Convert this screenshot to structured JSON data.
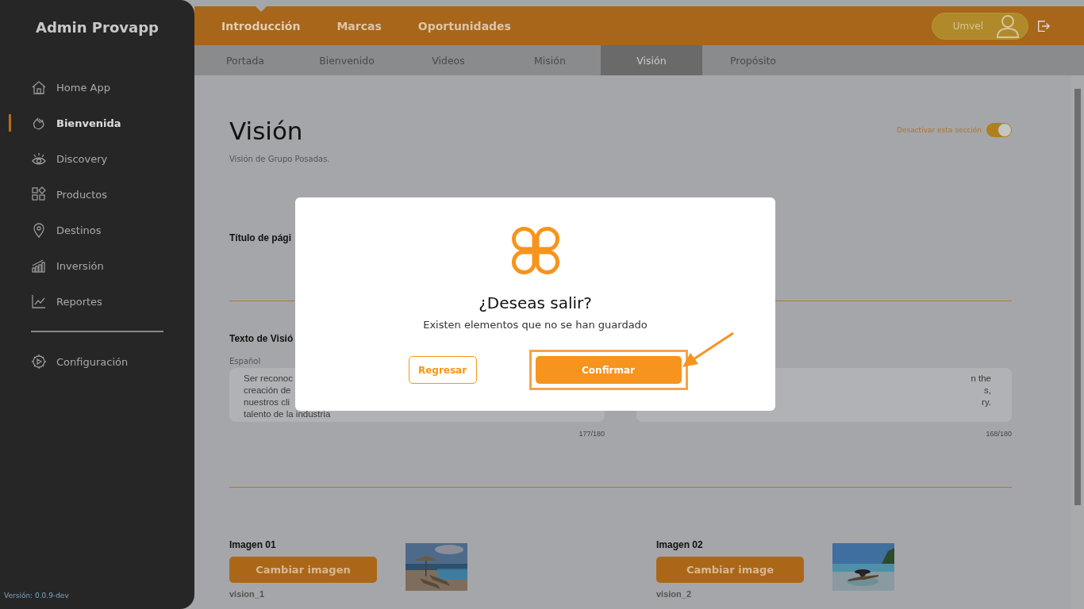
{
  "sidebar": {
    "title": "Admin Provapp",
    "items": [
      {
        "label": "Home App",
        "selected": false
      },
      {
        "label": "Bienvenida",
        "selected": true
      },
      {
        "label": "Discovery",
        "selected": false
      },
      {
        "label": "Productos",
        "selected": false
      },
      {
        "label": "Destinos",
        "selected": false
      },
      {
        "label": "Inversión",
        "selected": false
      },
      {
        "label": "Reportes",
        "selected": false
      }
    ],
    "settings": {
      "label": "Configuración",
      "selected": false
    },
    "version": "Versión: 0.0.9-dev"
  },
  "topnav": {
    "items": [
      {
        "label": "Introducción",
        "selected": true
      },
      {
        "label": "Marcas",
        "selected": false
      },
      {
        "label": "Oportunidades",
        "selected": false
      }
    ],
    "user": "Umvel"
  },
  "tabs": [
    {
      "label": "Portada",
      "selected": false
    },
    {
      "label": "Bienvenido",
      "selected": false
    },
    {
      "label": "Videos",
      "selected": false
    },
    {
      "label": "Misión",
      "selected": false
    },
    {
      "label": "Visión",
      "selected": true
    },
    {
      "label": "Propósito",
      "selected": false
    }
  ],
  "page": {
    "title": "Visión",
    "subtitle": "Visión de Grupo Posadas.",
    "toggle": {
      "label": "Desactivar esta sección",
      "on": true
    },
    "title_field": {
      "label": "Título de pági"
    },
    "text_field": {
      "label": "Texto de Visió",
      "language": "Español",
      "left_lines": [
        "Ser reconoc",
        "creación de",
        "nuestros cli",
        "talento de la industria"
      ],
      "left_count": "177/180",
      "right_lines": [
        "n the",
        "s,",
        "ry."
      ],
      "right_count": "168/180"
    },
    "images": [
      {
        "label": "Imagen 01",
        "button": "Cambiar imagen",
        "file": "vision_1",
        "kind": "picture"
      },
      {
        "label": "Imagen 02",
        "button": "Cambiar image",
        "file": "vision_2",
        "kind": "picture"
      }
    ]
  },
  "modal": {
    "title": "¿Deseas salir?",
    "message": "Existen elementos que no se han guardado",
    "buttons": [
      {
        "label": "Regresar",
        "kind": "secondary",
        "highlighted": false
      },
      {
        "label": "Confirmar",
        "kind": "primary",
        "highlighted": true
      }
    ]
  }
}
